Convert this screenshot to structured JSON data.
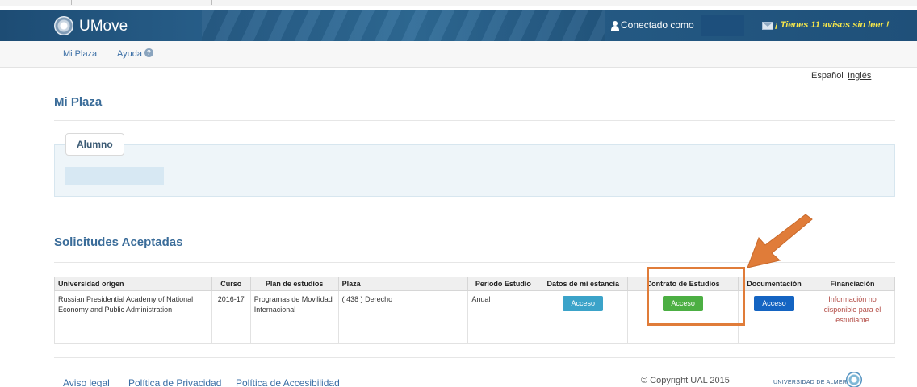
{
  "header": {
    "brand": "UMove",
    "connected_label": "Conectado como",
    "notices": "¡ Tienes 11 avisos sin leer !"
  },
  "nav": {
    "items": [
      "Mi Plaza",
      "Ayuda"
    ]
  },
  "language": {
    "current": "Español",
    "other": "Inglés"
  },
  "page": {
    "title": "Mi Plaza",
    "student_tab": "Alumno",
    "section_title": "Solicitudes Aceptadas"
  },
  "table": {
    "headers": [
      "Universidad origen",
      "Curso",
      "Plan de estudios",
      "Plaza",
      "Periodo Estudio",
      "Datos de mi estancia",
      "Contrato de Estudios",
      "Documentación",
      "Financiación"
    ],
    "row": {
      "university": "Russian Presidential Academy of National Economy and Public Administration",
      "course": "2016-17",
      "plan": "Programas de Movilidad Internacional",
      "plaza": "( 438 ) Derecho",
      "period": "Anual",
      "stay_button": "Acceso",
      "contract_button": "Acceso",
      "docs_button": "Acceso",
      "financing": "Información no disponible para el estudiante"
    }
  },
  "footer": {
    "links": [
      "Aviso legal",
      "Política de Privacidad",
      "Política de Accesibilidad"
    ],
    "copyright": "© Copyright UAL 2015",
    "university": "UNIVERSIDAD DE ALMERÍA"
  },
  "colors": {
    "header_blue": "#285f8a",
    "title_blue": "#3a6c99",
    "annotation_orange": "#e07c39",
    "button_info": "#3ba3c9",
    "button_success": "#4caf43",
    "button_primary": "#1464c2",
    "warning_text": "#b24a43",
    "notice_yellow": "#f6e64a"
  },
  "icons": [
    "logo-icon",
    "user-icon",
    "mail-icon",
    "help-icon",
    "ual-logo-icon"
  ]
}
